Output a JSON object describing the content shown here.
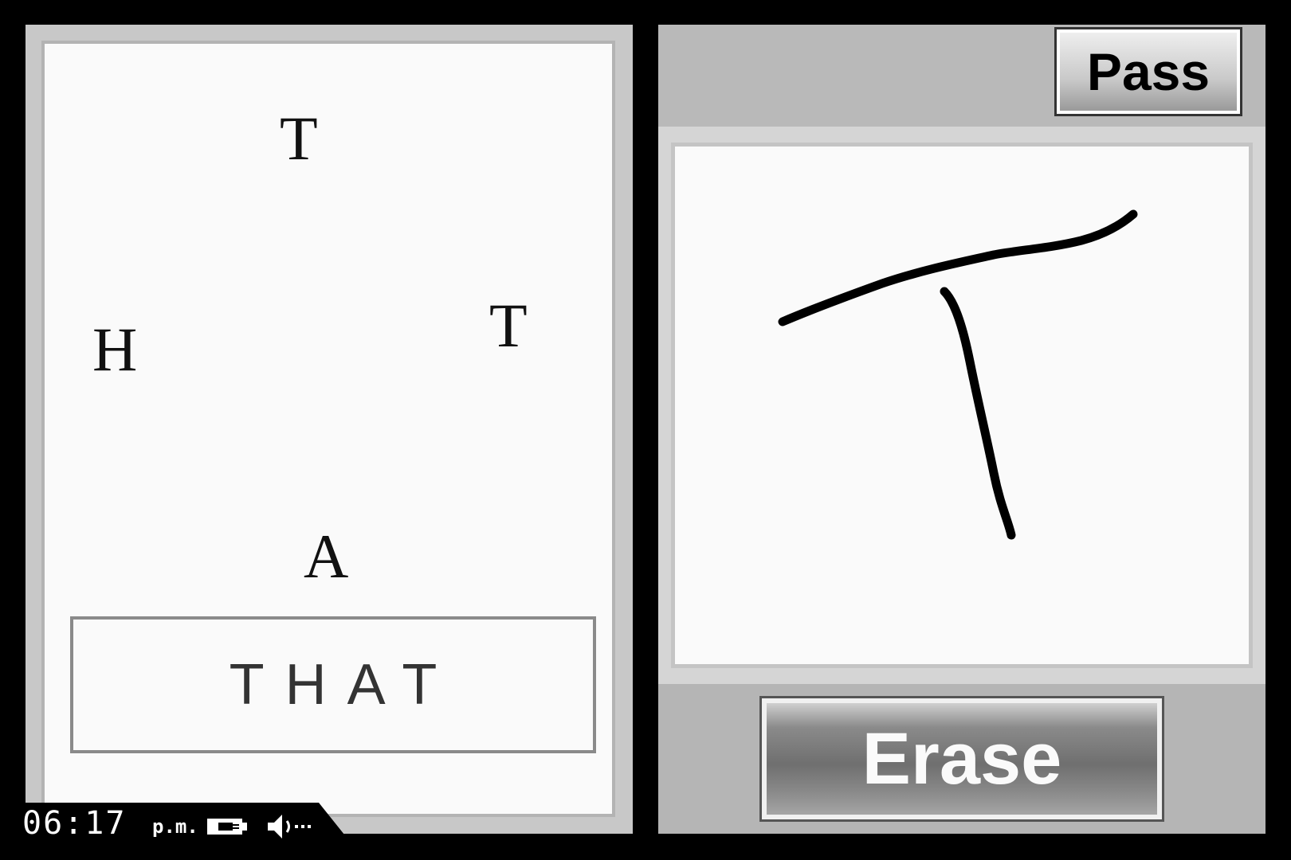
{
  "puzzle": {
    "scrambled_letters": [
      "T",
      "H",
      "T",
      "A"
    ],
    "answer": "THAT"
  },
  "status": {
    "time": "06:17",
    "ampm": "p.m."
  },
  "controls": {
    "pass_label": "Pass",
    "erase_label": "Erase"
  },
  "icons": {
    "battery": "battery-plug-icon",
    "speaker": "speaker-volume-icon"
  },
  "drawing": {
    "character": "T",
    "ink_color": "#000000"
  }
}
